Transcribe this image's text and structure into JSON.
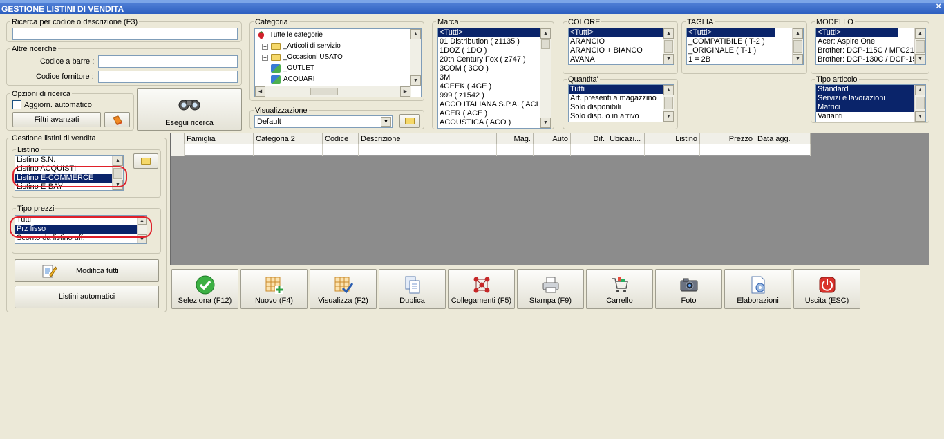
{
  "window": {
    "title": "GESTIONE LISTINI DI VENDITA",
    "close_label": "×"
  },
  "search": {
    "label": "Ricerca per codice o descrizione (F3)",
    "value": ""
  },
  "other_searches": {
    "label": "Altre ricerche",
    "barcode_label": "Codice a barre :",
    "supplier_label": "Codice fornitore :"
  },
  "options": {
    "label": "Opzioni di ricerca",
    "auto_update": "Aggiorn. automatico",
    "advanced_filters": "Filtri avanzati"
  },
  "run_search": "Esegui ricerca",
  "category": {
    "label": "Categoria",
    "items": [
      "Tutte le categorie",
      "_Articoli di servizio",
      "_Occasioni USATO",
      "_OUTLET",
      "ACQUARI"
    ]
  },
  "visualization": {
    "label": "Visualizzazione",
    "value": "Default"
  },
  "brand": {
    "label": "Marca",
    "items": [
      "<Tutti>",
      "01 Distribution ( z1135 )",
      "1DOZ ( 1DO )",
      "20th Century Fox ( z747 )",
      "3COM ( 3CO )",
      "3M",
      "4GEEK ( 4GE )",
      "999 ( z1542 )",
      "ACCO ITALIANA S.P.A. ( ACI",
      "ACER ( ACE )",
      "ACOUSTICA ( ACO )"
    ]
  },
  "color": {
    "label": "COLORE",
    "items": [
      "<Tutti>",
      "ARANCIO",
      "ARANCIO + BIANCO",
      "AVANA"
    ]
  },
  "size": {
    "label": "TAGLIA",
    "items": [
      "<Tutti>",
      "_COMPATIBILE ( T-2 )",
      "_ORIGINALE ( T-1 )",
      "1 = 2B"
    ]
  },
  "model": {
    "label": "MODELLO",
    "items": [
      "<Tutti>",
      "Acer: Aspire One",
      "Brother: DCP-115C / MFC21",
      "Brother: DCP-130C / DCP-15"
    ]
  },
  "quantity": {
    "label": "Quantita'",
    "items": [
      "Tutti",
      "Art. presenti a magazzino",
      "Solo disponibili",
      "Solo disp. o in arrivo"
    ]
  },
  "article_type": {
    "label": "Tipo articolo",
    "items": [
      "Standard",
      "Servizi e lavorazioni",
      "Matrici",
      "Varianti"
    ]
  },
  "price_lists": {
    "label": "Gestione listini di vendita",
    "listino_label": "Listino",
    "listino_items": [
      "Listino S.N.",
      "Listino ACQUISTI",
      "Listino E-COMMERCE",
      "Listino E-BAY"
    ],
    "price_type_label": "Tipo prezzi",
    "price_type_items": [
      "Tutti",
      "Prz fisso",
      "Sconto da listino uff."
    ],
    "edit_all": "Modifica tutti",
    "auto_lists": "Listini automatici"
  },
  "grid": {
    "columns": [
      "Famiglia",
      "Categoria 2",
      "Codice",
      "Descrizione",
      "Mag.",
      "Auto",
      "Dif.",
      "Ubicazi...",
      "Listino",
      "Prezzo",
      "Data agg."
    ]
  },
  "toolbar": {
    "select": "Seleziona (F12)",
    "new": "Nuovo (F4)",
    "view": "Visualizza (F2)",
    "duplicate": "Duplica",
    "links": "Collegamenti (F5)",
    "print": "Stampa (F9)",
    "cart": "Carrello",
    "photo": "Foto",
    "processing": "Elaborazioni",
    "exit": "Uscita (ESC)"
  },
  "colors": {
    "selection": "#0a246a",
    "highlight_ring": "#e0202a",
    "title_bar": "#2d5fc0"
  }
}
